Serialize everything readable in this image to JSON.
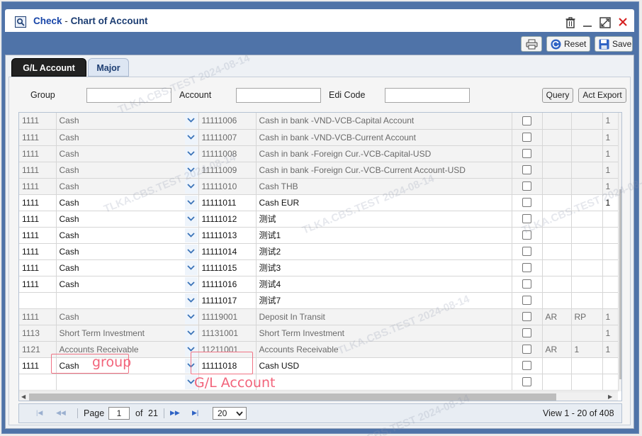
{
  "window": {
    "app": "Check",
    "separator": "-",
    "title": "Chart of Account"
  },
  "toolbar": {
    "reset_label": "Reset",
    "save_label": "Save"
  },
  "tabs": [
    {
      "label": "G/L Account",
      "active": true
    },
    {
      "label": "Major",
      "active": false
    }
  ],
  "filters": {
    "group_label": "Group",
    "group_value": "",
    "account_label": "Account",
    "account_value": "",
    "edi_label": "Edi Code",
    "edi_value": "",
    "query_label": "Query",
    "export_label": "Act Export"
  },
  "rows": [
    {
      "code": "1111",
      "group": "Cash",
      "account": "11111006",
      "name": "Cash in bank -VND-VCB-Capital Account",
      "c1": "",
      "c2": "",
      "c3": "1",
      "editable": false
    },
    {
      "code": "1111",
      "group": "Cash",
      "account": "11111007",
      "name": "Cash in bank -VND-VCB-Current Account",
      "c1": "",
      "c2": "",
      "c3": "1",
      "editable": false
    },
    {
      "code": "1111",
      "group": "Cash",
      "account": "11111008",
      "name": "Cash in bank -Foreign Cur.-VCB-Capital-USD",
      "c1": "",
      "c2": "",
      "c3": "1",
      "editable": false
    },
    {
      "code": "1111",
      "group": "Cash",
      "account": "11111009",
      "name": "Cash in bank -Foreign Cur.-VCB-Current Account-USD",
      "c1": "",
      "c2": "",
      "c3": "1",
      "editable": false
    },
    {
      "code": "1111",
      "group": "Cash",
      "account": "11111010",
      "name": "Cash THB",
      "c1": "",
      "c2": "",
      "c3": "1",
      "editable": false
    },
    {
      "code": "1111",
      "group": "Cash",
      "account": "11111011",
      "name": "Cash EUR",
      "c1": "",
      "c2": "",
      "c3": "1",
      "editable": true
    },
    {
      "code": "1111",
      "group": "Cash",
      "account": "11111012",
      "name": "测试",
      "c1": "",
      "c2": "",
      "c3": "",
      "editable": true
    },
    {
      "code": "1111",
      "group": "Cash",
      "account": "11111013",
      "name": "测试1",
      "c1": "",
      "c2": "",
      "c3": "",
      "editable": true
    },
    {
      "code": "1111",
      "group": "Cash",
      "account": "11111014",
      "name": "测试2",
      "c1": "",
      "c2": "",
      "c3": "",
      "editable": true
    },
    {
      "code": "1111",
      "group": "Cash",
      "account": "11111015",
      "name": "测试3",
      "c1": "",
      "c2": "",
      "c3": "",
      "editable": true
    },
    {
      "code": "1111",
      "group": "Cash",
      "account": "11111016",
      "name": "测试4",
      "c1": "",
      "c2": "",
      "c3": "",
      "editable": true
    },
    {
      "code": "",
      "group": "",
      "account": "11111017",
      "name": "测试7",
      "c1": "",
      "c2": "",
      "c3": "",
      "editable": true
    },
    {
      "code": "1111",
      "group": "Cash",
      "account": "11119001",
      "name": "Deposit In Transit",
      "c1": "AR",
      "c2": "RP",
      "c3": "1",
      "editable": false
    },
    {
      "code": "1113",
      "group": "Short Term Investment",
      "account": "11131001",
      "name": "Short Term Investment",
      "c1": "",
      "c2": "",
      "c3": "1",
      "editable": false
    },
    {
      "code": "1121",
      "group": "Accounts Receivable",
      "account": "11211001",
      "name": "Accounts Receivable",
      "c1": "AR",
      "c2": "1",
      "c3": "1",
      "editable": false
    },
    {
      "code": "1111",
      "group": "Cash",
      "account": "11111018",
      "name": "Cash USD",
      "c1": "",
      "c2": "",
      "c3": "",
      "editable": true
    },
    {
      "code": "",
      "group": "",
      "account": "",
      "name": "",
      "c1": "",
      "c2": "",
      "c3": "",
      "editable": true
    }
  ],
  "pager": {
    "page_label": "Page",
    "page": "1",
    "of_label": "of",
    "total_pages": "21",
    "page_size": "20",
    "view_text": "View  1 - 20 of 408"
  },
  "watermark": "TLKA.CBS.TEST 2024-08-14",
  "annotations": {
    "group": "group",
    "account": "G/L Account"
  },
  "colors": {
    "frame": "#4f73a8",
    "title": "#1c3d72",
    "annotation": "#f2637a"
  }
}
